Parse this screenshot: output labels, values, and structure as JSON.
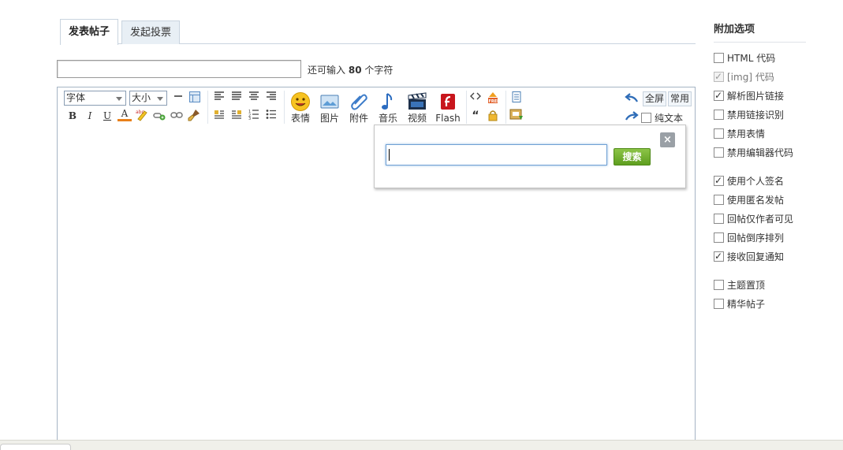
{
  "tabs": [
    {
      "label": "发表帖子",
      "active": true
    },
    {
      "label": "发起投票",
      "active": false
    }
  ],
  "subject": {
    "value": "",
    "remain_prefix": "还可输入",
    "remain_count": "80",
    "remain_suffix": "个字符"
  },
  "toolbar": {
    "font_select": "字体",
    "size_select": "大小",
    "bold": "B",
    "italic": "I",
    "underline": "U",
    "fontcolor": "A",
    "big_buttons": [
      {
        "label": "表情",
        "icon": "smiley-icon"
      },
      {
        "label": "图片",
        "icon": "image-icon"
      },
      {
        "label": "附件",
        "icon": "paperclip-icon"
      },
      {
        "label": "音乐",
        "icon": "music-note-icon"
      },
      {
        "label": "视频",
        "icon": "video-clapper-icon"
      },
      {
        "label": "Flash",
        "icon": "flash-icon"
      }
    ],
    "fullscreen": "全屏",
    "common": "常用",
    "plaintext": "纯文本",
    "plaintext_checked": false
  },
  "search_popup": {
    "input_value": "",
    "search_button": "搜索",
    "close": "×"
  },
  "sidebar": {
    "title": "附加选项",
    "groups": [
      [
        {
          "label": "HTML 代码",
          "checked": false,
          "disabled": false
        },
        {
          "label": "[img] 代码",
          "checked": true,
          "disabled": true
        },
        {
          "label": "解析图片链接",
          "checked": true,
          "disabled": false
        },
        {
          "label": "禁用链接识别",
          "checked": false,
          "disabled": false
        },
        {
          "label": "禁用表情",
          "checked": false,
          "disabled": false
        },
        {
          "label": "禁用编辑器代码",
          "checked": false,
          "disabled": false
        }
      ],
      [
        {
          "label": "使用个人签名",
          "checked": true,
          "disabled": false
        },
        {
          "label": "使用匿名发帖",
          "checked": false,
          "disabled": false
        },
        {
          "label": "回帖仅作者可见",
          "checked": false,
          "disabled": false
        },
        {
          "label": "回帖倒序排列",
          "checked": false,
          "disabled": false
        },
        {
          "label": "接收回复通知",
          "checked": true,
          "disabled": false
        }
      ],
      [
        {
          "label": "主题置顶",
          "checked": false,
          "disabled": false
        },
        {
          "label": "精华帖子",
          "checked": false,
          "disabled": false
        }
      ]
    ]
  },
  "colors": {
    "accent_green": "#6aab28",
    "border_blue": "#a5b4c4",
    "tab_bg": "#e8eff5"
  }
}
